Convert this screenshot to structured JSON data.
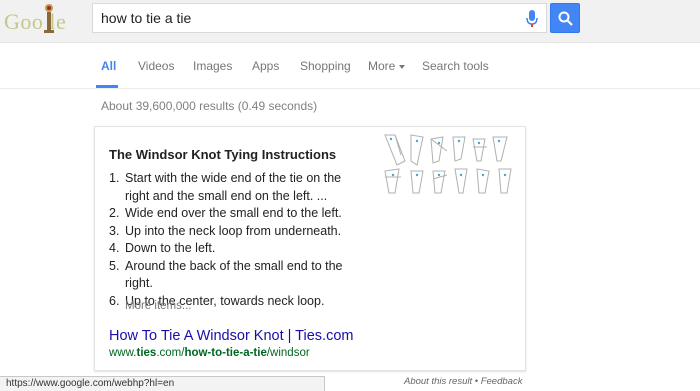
{
  "header": {
    "logo_text": "Goo   le",
    "search_value": "how to tie a tie"
  },
  "tabs": [
    {
      "label": "All",
      "active": true
    },
    {
      "label": "Videos"
    },
    {
      "label": "Images"
    },
    {
      "label": "Apps"
    },
    {
      "label": "Shopping"
    },
    {
      "label": "More"
    },
    {
      "label": "Search tools"
    }
  ],
  "result_stats": "About 39,600,000 results (0.49 seconds)",
  "snippet": {
    "title": "The Windsor Knot Tying Instructions",
    "steps": [
      {
        "num": "1.",
        "lines": [
          "Start with the wide end of the tie on the",
          "right and the small end on the left. ..."
        ]
      },
      {
        "num": "2.",
        "lines": [
          "Wide end over the small end to the left."
        ]
      },
      {
        "num": "3.",
        "lines": [
          "Up into the neck loop from underneath."
        ]
      },
      {
        "num": "4.",
        "lines": [
          "Down to the left."
        ]
      },
      {
        "num": "5.",
        "lines": [
          "Around the back of the small end to the right."
        ]
      },
      {
        "num": "6.",
        "lines": [
          "Up to the center, towards neck loop."
        ]
      }
    ],
    "more_items": "More items...",
    "link_text": "How To Tie A Windsor Knot | Ties.com",
    "url_prefix": "www.",
    "url_bold1": "ties",
    "url_mid": ".com/",
    "url_bold2": "how-to-tie-a-tie",
    "url_suffix": "/windsor"
  },
  "footer": {
    "status_url": "https://www.google.com/webhp?hl=en",
    "feedback": "About this result • Feedback"
  },
  "colors": {
    "accent": "#4285f4",
    "link": "#1a0dab",
    "url": "#006621"
  }
}
